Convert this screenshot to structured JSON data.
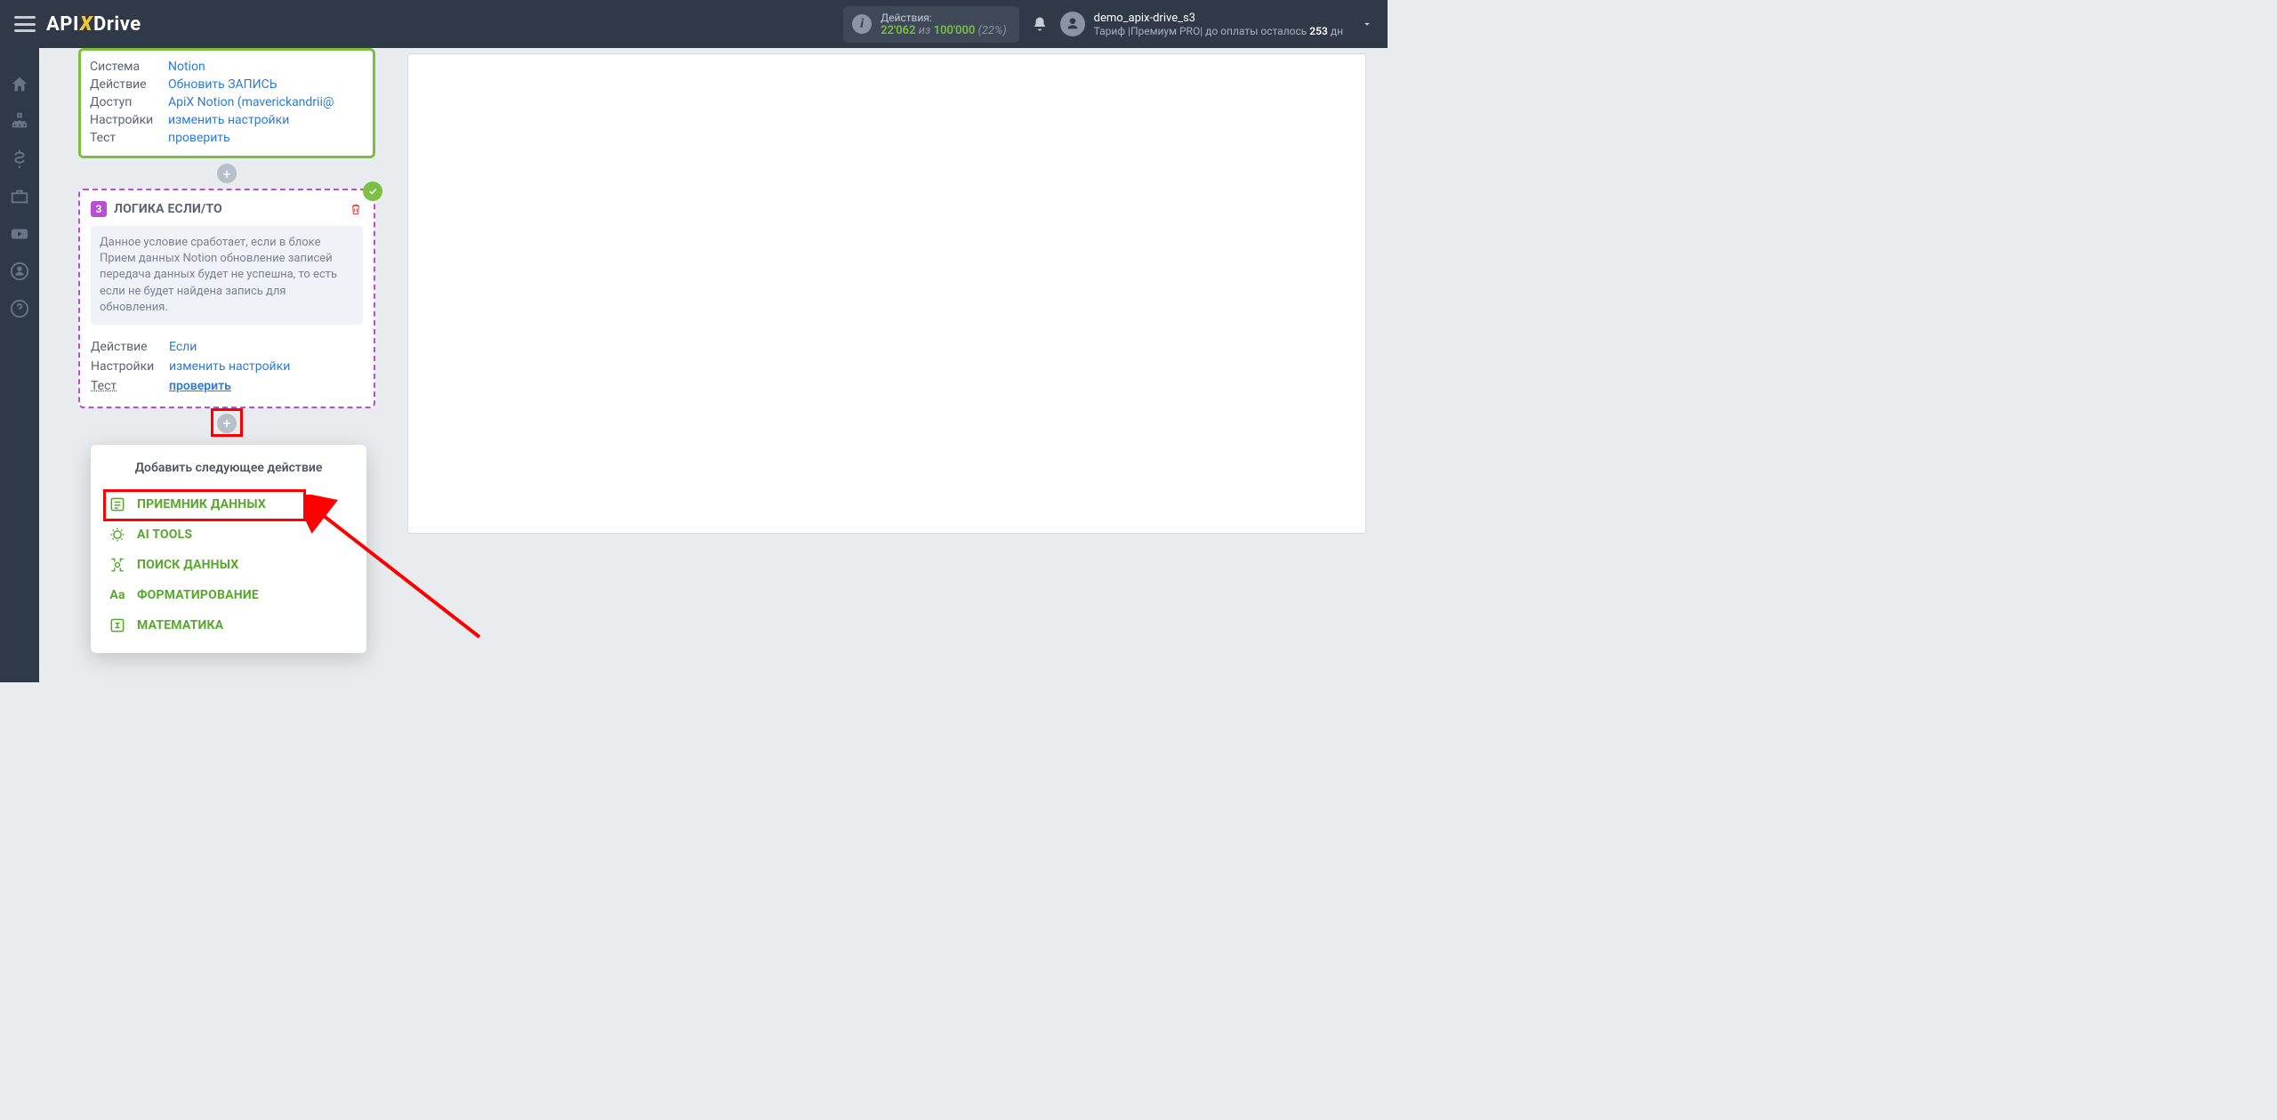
{
  "header": {
    "actions_label": "Действия:",
    "actions_used": "22'062",
    "actions_of": "из",
    "actions_total": "100'000",
    "actions_pct": "(22%)",
    "username": "demo_apix-drive_s3",
    "tariff_prefix": "Тариф |",
    "tariff_name": "Премиум PRO",
    "tariff_mid": "| до оплаты осталось ",
    "days_left": "253",
    "days_unit": "дн"
  },
  "logo": {
    "api": "API",
    "drive": "Drive"
  },
  "block2": {
    "rows": {
      "system_k": "Система",
      "system_v": "Notion",
      "action_k": "Действие",
      "action_v": "Обновить ЗАПИСЬ",
      "access_k": "Доступ",
      "access_v": "ApiX Notion (maverickandrii@",
      "settings_k": "Настройки",
      "settings_v": "изменить настройки",
      "test_k": "Тест",
      "test_v": "проверить"
    }
  },
  "block3": {
    "badge": "3",
    "title": "ЛОГИКА ЕСЛИ/ТО",
    "description": "Данное условие сработает, если в блоке Прием данных Notion обновление записей передача данных будет не успешна, то есть если не будет найдена запись для обновления.",
    "rows": {
      "action_k": "Действие",
      "action_v": "Если",
      "settings_k": "Настройки",
      "settings_v": "изменить настройки",
      "test_k": "Тест",
      "test_v": "проверить"
    }
  },
  "popup": {
    "title": "Добавить следующее действие",
    "items": [
      "ПРИЕМНИК ДАННЫХ",
      "AI TOOLS",
      "ПОИСК ДАННЫХ",
      "ФОРМАТИРОВАНИЕ",
      "МАТЕМАТИКА"
    ]
  }
}
